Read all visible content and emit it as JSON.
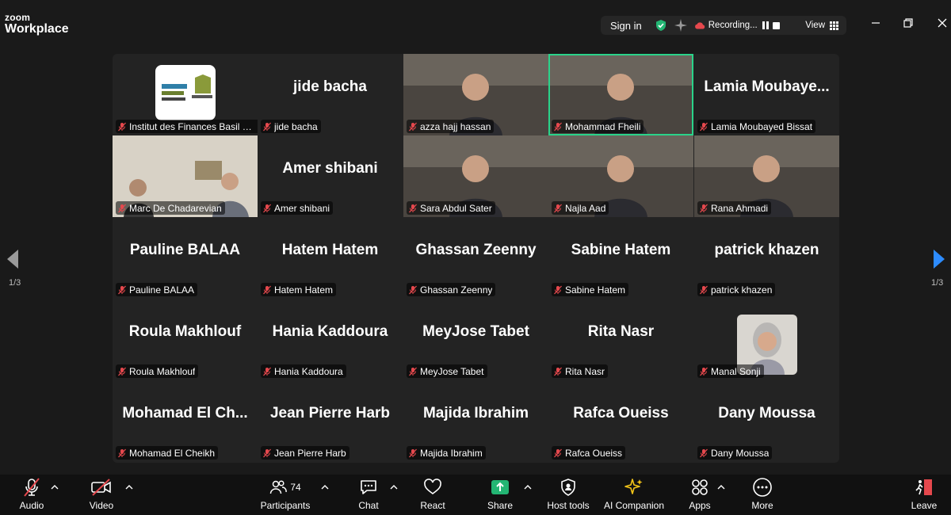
{
  "app": {
    "brand_top": "zoom",
    "brand_bottom": "Workplace"
  },
  "topbar": {
    "sign_in": "Sign in",
    "recording": "Recording...",
    "view": "View"
  },
  "tiles": [
    {
      "big": "",
      "label": "Institut des Finances Basil Fu...",
      "video": "logo"
    },
    {
      "big": "jide bacha",
      "label": "jide bacha"
    },
    {
      "big": "",
      "label": "azza hajj hassan",
      "video": "person"
    },
    {
      "big": "",
      "label": "Mohammad Fheili",
      "video": "person",
      "active": true
    },
    {
      "big": "Lamia  Moubaye...",
      "label": "Lamia Moubayed Bissat"
    },
    {
      "big": "",
      "label": "Marc De Chadarevian",
      "video": "room"
    },
    {
      "big": "Amer shibani",
      "label": "Amer shibani"
    },
    {
      "big": "",
      "label": "Sara Abdul Sater",
      "video": "person"
    },
    {
      "big": "",
      "label": "Najla Aad",
      "video": "person"
    },
    {
      "big": "",
      "label": "Rana Ahmadi",
      "video": "person"
    },
    {
      "big": "Pauline BALAA",
      "label": "Pauline BALAA"
    },
    {
      "big": "Hatem Hatem",
      "label": "Hatem Hatem"
    },
    {
      "big": "Ghassan Zeenny",
      "label": "Ghassan Zeenny"
    },
    {
      "big": "Sabine Hatem",
      "label": "Sabine Hatem"
    },
    {
      "big": "patrick khazen",
      "label": "patrick khazen"
    },
    {
      "big": "Roula Makhlouf",
      "label": "Roula Makhlouf"
    },
    {
      "big": "Hania Kaddoura",
      "label": "Hania Kaddoura"
    },
    {
      "big": "MeyJose Tabet",
      "label": "MeyJose Tabet"
    },
    {
      "big": "Rita Nasr",
      "label": "Rita Nasr"
    },
    {
      "big": "",
      "label": "Manal Sonji",
      "video": "avatar"
    },
    {
      "big": "Mohamad  El  Ch...",
      "label": "Mohamad El Cheikh"
    },
    {
      "big": "Jean Pierre Harb",
      "label": "Jean Pierre Harb"
    },
    {
      "big": "Majida Ibrahim",
      "label": "Majida Ibrahim"
    },
    {
      "big": "Rafca Oueiss",
      "label": "Rafca Oueiss"
    },
    {
      "big": "Dany Moussa",
      "label": "Dany Moussa"
    }
  ],
  "pagination": {
    "left": "1/3",
    "right": "1/3"
  },
  "toolbar": {
    "audio": "Audio",
    "video": "Video",
    "participants": "Participants",
    "participants_count": "74",
    "chat": "Chat",
    "react": "React",
    "share": "Share",
    "host_tools": "Host tools",
    "ai_companion": "AI Companion",
    "apps": "Apps",
    "more": "More",
    "leave": "Leave"
  },
  "colors": {
    "accent_green": "#2ad38a",
    "share_green": "#23b573",
    "muted_red": "#e5484d",
    "nav_arrow": "#2d8cff"
  }
}
